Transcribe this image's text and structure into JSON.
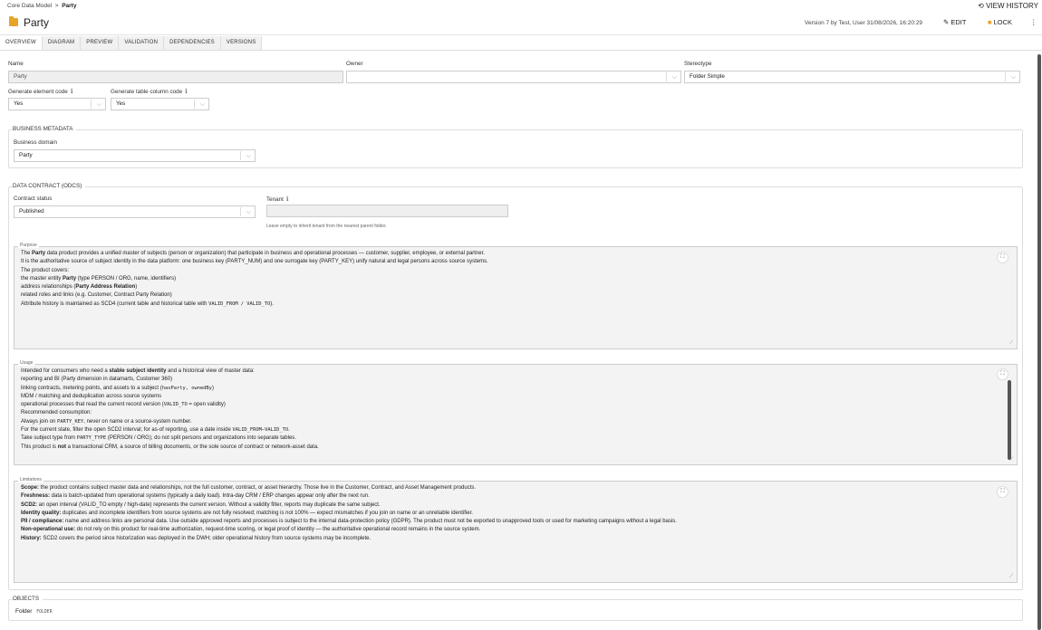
{
  "breadcrumb": {
    "root": "Core Data Model",
    "separator": ">",
    "current": "Party"
  },
  "header": {
    "view_history": "VIEW HISTORY",
    "title": "Party",
    "version_info": "Version 7 by Test, User 31/08/2026, 16:20:29",
    "edit": "EDIT",
    "lock": "LOCK",
    "more": "⋮"
  },
  "tabs": [
    {
      "label": "OVERVIEW"
    },
    {
      "label": "DIAGRAM"
    },
    {
      "label": "PREVIEW"
    },
    {
      "label": "VALIDATION"
    },
    {
      "label": "DEPENDENCIES"
    },
    {
      "label": "VERSIONS"
    }
  ],
  "general": {
    "name_label": "Name",
    "name_value": "Party",
    "owner_label": "Owner",
    "owner_value": "",
    "stereotype_label": "Stereotype",
    "stereotype_value": "Folder Simple",
    "gen_element_label": "Generate element code",
    "gen_element_value": "Yes",
    "gen_table_label": "Generate table column code",
    "gen_table_value": "Yes"
  },
  "business_metadata": {
    "title": "BUSINESS METADATA",
    "domain_label": "Business domain",
    "domain_value": "Party"
  },
  "data_contract": {
    "title": "DATA CONTRACT (ODCS)",
    "status_label": "Contract status",
    "status_value": "Published",
    "tenant_label": "Tenant",
    "tenant_value": "",
    "tenant_hint": "Leave empty to inherit tenant from the nearest parent folder."
  },
  "purpose": {
    "label": "Purpose",
    "lines": [
      {
        "pre": "The ",
        "bold": "Party",
        "post": " data product provides a unified master of subjects (person or organization) that participate in business and operational processes — customer, supplier, employee, or external partner."
      },
      {
        "pre": "It is the authoritative source of subject identity in the data platform: one business key (PARTY_NUM) and one surrogate key (PARTY_KEY) unify natural and legal persons across source systems.",
        "bold": "",
        "post": ""
      },
      {
        "pre": "The product covers:",
        "bold": "",
        "post": ""
      },
      {
        "pre": "the master entity ",
        "bold": "Party",
        "post": " (type PERSON / ORG, name, identifiers)"
      },
      {
        "pre": "address relationships (",
        "bold": "Party Address Relation",
        "post": ")"
      },
      {
        "pre": "related roles and links (e.g. Customer, Contract Party Relation)",
        "bold": "",
        "post": ""
      },
      {
        "pre": "Attribute history is maintained as SCD4 (current table and historical table with ",
        "mono": "VALID_FROM / VALID_TO",
        "post": ")."
      }
    ]
  },
  "usage": {
    "label": "Usage",
    "lines": [
      {
        "pre": "Intended for consumers who need a ",
        "bold": "stable subject identity",
        "post": " and a historical view of master data:"
      },
      {
        "pre": "reporting and BI (Party dimension in datamarts, Customer 360)",
        "bold": "",
        "post": ""
      },
      {
        "pre": "linking contracts, metering points, and assets to a subject (",
        "mono": "hasParty, ownedBy",
        "post": ")"
      },
      {
        "pre": "MDM / matching and deduplication across source systems",
        "bold": "",
        "post": ""
      },
      {
        "pre": "operational processes that read the current record version (",
        "mono": "VALID_TO",
        "post": " = open validity)"
      },
      {
        "pre": "Recommended consumption:",
        "bold": "",
        "post": ""
      },
      {
        "pre": "Always join on ",
        "mono": "PARTY_KEY",
        "post": ", never on name or a source-system number."
      },
      {
        "pre": "For the current state, filter the open SCD2 interval; for as-of reporting, use a date inside ",
        "mono": "VALID_FROM–VALID_TO",
        "post": "."
      },
      {
        "pre": "Take subject type from ",
        "mono": "PARTY_TYPE",
        "post": " (PERSON / ORG); do not split persons and organizations into separate tables."
      },
      {
        "pre": "This product is ",
        "bold": "not",
        "post": " a transactional CRM, a source of billing documents, or the sole source of contract or network-asset data."
      }
    ]
  },
  "limitations": {
    "label": "Limitations",
    "lines": [
      {
        "bold": "Scope:",
        "post": " the product contains subject master data and relationships, not the full customer, contract, or asset hierarchy. Those live in the Customer, Contract, and Asset Management products."
      },
      {
        "bold": "Freshness:",
        "post": " data is batch-updated from operational systems (typically a daily load). Intra-day CRM / ERP changes appear only after the next run."
      },
      {
        "bold": "SCD2:",
        "post": " an open interval (VALID_TO empty / high-date) represents the current version. Without a validity filter, reports may duplicate the same subject."
      },
      {
        "bold": "Identity quality:",
        "post": " duplicates and incomplete identifiers from source systems are not fully resolved; matching is not 100% — expect mismatches if you join on name or an unreliable identifier."
      },
      {
        "bold": "PII / compliance:",
        "post": " name and address links are personal data. Use outside approved reports and processes is subject to the internal data-protection policy (GDPR). The product must not be exported to unapproved tools or used for marketing campaigns without a legal basis."
      },
      {
        "bold": "Non-operational use:",
        "post": " do not rely on this product for real-time authorization, request-time scoring, or legal proof of identity — the authoritative operational record remains in the source system."
      },
      {
        "bold": "History:",
        "post": " SCD2 covers the period since historization was deployed in the DWH; older operational history from source systems may be incomplete."
      }
    ]
  },
  "objects": {
    "title": "OBJECTS",
    "item_name": "Folder",
    "item_type": "FOLDER"
  }
}
